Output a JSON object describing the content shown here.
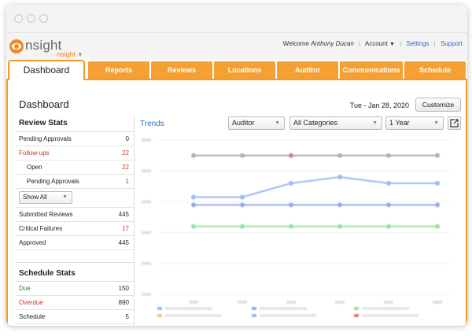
{
  "app": {
    "logo_word": "nsight",
    "logo_sub": "nsight"
  },
  "topnav": {
    "welcome": "Welcome",
    "user": "Anthony Ducan",
    "account": "Account",
    "settings": "Settings",
    "support": "Support"
  },
  "tabs": [
    "Dashboard",
    "Reports",
    "Reviews",
    "Locations",
    "Auditor",
    "Communications",
    "Schedule"
  ],
  "page": {
    "title": "Dashboard",
    "date": "Tue - Jan 28, 2020",
    "customize": "Customize"
  },
  "review_stats": {
    "title": "Review Stats",
    "rows": [
      {
        "label": "Pending Approvals",
        "value": "0"
      },
      {
        "label": "Follow-ups",
        "value": "22"
      },
      {
        "label": "Open",
        "value": "22"
      },
      {
        "label": "Pending Approvals",
        "value": "1"
      }
    ],
    "show_all": "Show All",
    "rows2": [
      {
        "label": "Submitted Reviews",
        "value": "445"
      },
      {
        "label": "Critical Failures",
        "value": "17"
      },
      {
        "label": "Approved",
        "value": "445"
      }
    ]
  },
  "schedule_stats": {
    "title": "Schedule Stats",
    "rows": [
      {
        "label": "Due",
        "value": "150"
      },
      {
        "label": "Overdue",
        "value": "890"
      },
      {
        "label": "Schedule",
        "value": "5"
      }
    ]
  },
  "trends": {
    "title": "Trends",
    "filter_type": "Auditor",
    "filter_category": "All Categories",
    "filter_range": "1 Year"
  },
  "colors": {
    "accent": "#f39a2a",
    "tab": "#f6a033",
    "link": "#2a6bc7",
    "red": "#c0392b",
    "green": "#2e7d32"
  },
  "chart_data": {
    "type": "line",
    "categories": [
      "1",
      "2",
      "3",
      "4",
      "5",
      "6"
    ],
    "series": [
      {
        "values": [
          90,
          90,
          90,
          90,
          90,
          90
        ],
        "color": "#b0b0b0"
      },
      {
        "values": [
          63,
          63,
          72,
          76,
          72,
          72
        ],
        "color": "#9db8f2"
      },
      {
        "values": [
          58,
          58,
          58,
          58,
          58,
          58
        ],
        "color": "#9aa8f0"
      },
      {
        "values": [
          44,
          44,
          44,
          44,
          44,
          44
        ],
        "color": "#9be39b"
      }
    ],
    "marker": {
      "series": 0,
      "index": 2,
      "color": "#e87a7a"
    },
    "ylim": [
      0,
      100
    ],
    "grid": true
  },
  "icons": {
    "export": "external-link-icon",
    "logo": "eye-logo-icon"
  }
}
